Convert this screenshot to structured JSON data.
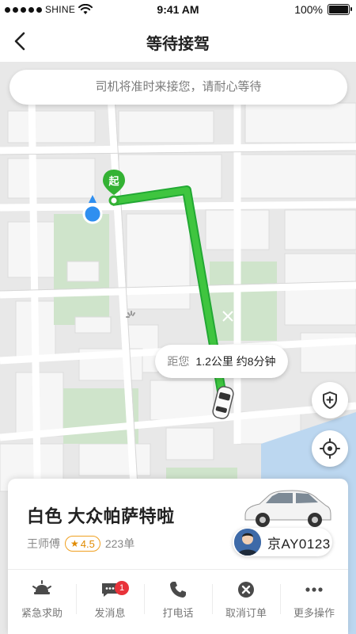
{
  "status_bar": {
    "carrier": "SHINE",
    "time": "9:41 AM",
    "battery": "100%"
  },
  "nav": {
    "title": "等待接驾"
  },
  "map": {
    "notice": "司机将准时来接您，请耐心等待",
    "start_marker": "起",
    "distance_label": "距您",
    "distance_value": "1.2公里 约8分钟"
  },
  "card": {
    "car_name": "白色 大众帕萨特啦",
    "driver_name": "王师傅",
    "rating": "4.5",
    "orders": "223单",
    "plate": "京AY0123"
  },
  "actions": [
    {
      "label": "紧急求助",
      "icon": "alarm-icon"
    },
    {
      "label": "发消息",
      "icon": "message-icon",
      "badge": "1"
    },
    {
      "label": "打电话",
      "icon": "phone-icon"
    },
    {
      "label": "取消订单",
      "icon": "cancel-icon"
    },
    {
      "label": "更多操作",
      "icon": "more-icon"
    }
  ],
  "colors": {
    "route": "#3fc53f",
    "route_dark": "#22a833",
    "location": "#2f8ff0",
    "accent": "#e8333a",
    "rating": "#f0a020"
  }
}
